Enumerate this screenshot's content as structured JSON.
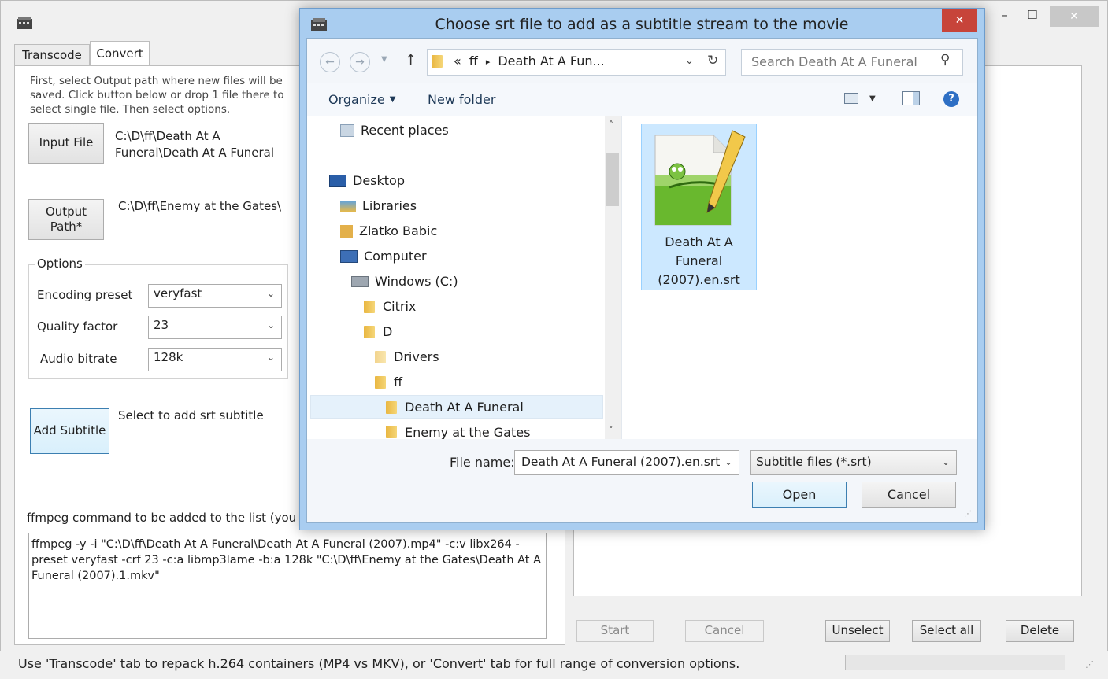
{
  "main_window": {
    "tabs": [
      "Transcode",
      "Convert"
    ],
    "instructions": "First, select Output path where new files will be saved. Click button below or drop 1 file there to select single file. Then select options.",
    "input_file_button": "Input File",
    "input_file_path": "C:\\D\\ff\\Death At A Funeral\\Death At A Funeral",
    "output_path_button": "Output Path*",
    "output_path_value": "C:\\D\\ff\\Enemy at the Gates\\",
    "options_label": "Options",
    "encoding_preset_label": "Encoding preset",
    "encoding_preset_value": "veryfast",
    "quality_factor_label": "Quality factor",
    "quality_factor_value": "23",
    "audio_bitrate_label": "Audio bitrate",
    "audio_bitrate_value": "128k",
    "add_subtitle_button": "Add Subtitle",
    "add_subtitle_hint": "Select to add srt subtitle",
    "ffmpeg_label": "ffmpeg command to be added to the list (you",
    "ffmpeg_command": "ffmpeg -y -i \"C:\\D\\ff\\Death At A Funeral\\Death At A Funeral (2007).mp4\" -c:v libx264 -preset veryfast -crf 23 -c:a libmp3lame -b:a 128k \"C:\\D\\ff\\Enemy at the Gates\\Death At A Funeral (2007).1.mkv\"",
    "buttons": {
      "start": "Start",
      "cancel": "Cancel",
      "unselect": "Unselect",
      "select_all": "Select all",
      "delete": "Delete"
    },
    "status_bar": "Use 'Transcode' tab to repack h.264 containers (MP4 vs MKV), or 'Convert' tab for full range of conversion options."
  },
  "dialog": {
    "title": "Choose srt file to add as a subtitle stream to the movie",
    "breadcrumb": [
      "«",
      "ff",
      "Death At A Fun..."
    ],
    "search_placeholder": "Search Death At A Funeral",
    "organize": "Organize",
    "new_folder": "New folder",
    "tree": [
      "Recent places",
      "Desktop",
      "Libraries",
      "Zlatko Babic",
      "Computer",
      "Windows (C:)",
      "Citrix",
      "D",
      "Drivers",
      "ff",
      "Death At A Funeral",
      "Enemy at the Gates"
    ],
    "file_item": "Death At A Funeral (2007).en.srt",
    "file_item_lines": [
      "Death At A",
      "Funeral",
      "(2007).en.srt"
    ],
    "file_name_label": "File name:",
    "file_name_value": "Death At A Funeral (2007).en.srt",
    "file_type_value": "Subtitle files (*.srt)",
    "open_button": "Open",
    "cancel_button": "Cancel",
    "close_glyph": "✕"
  },
  "colors": {
    "dialog_frame": "#9fc8ee",
    "dialog_close": "#c7443a",
    "selection": "#cce8ff",
    "selection_border": "#7eb4ea"
  }
}
